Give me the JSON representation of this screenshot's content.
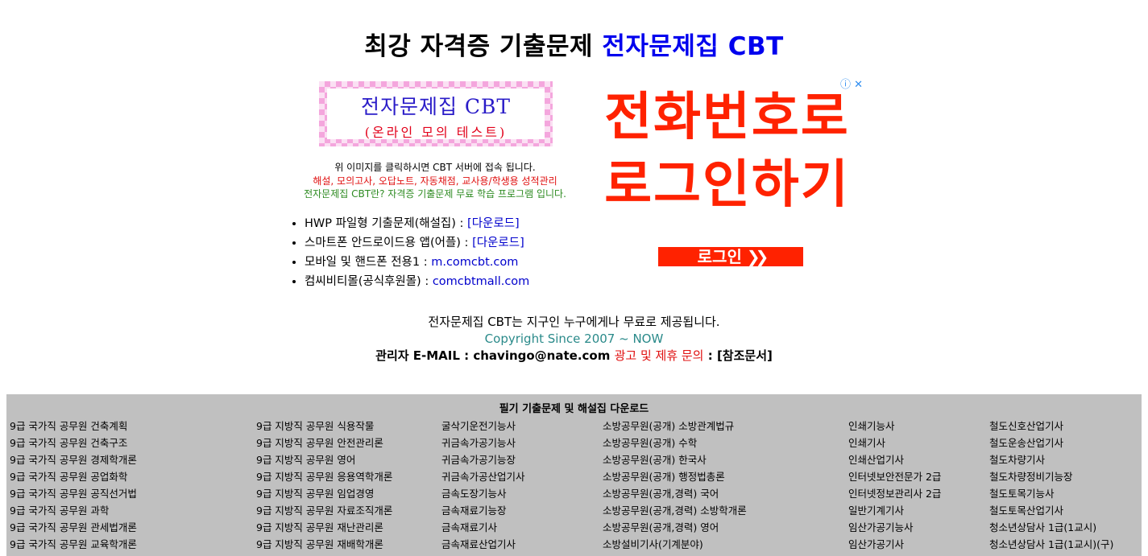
{
  "header": {
    "title_main": "최강 자격증 기출문제 ",
    "title_accent": "전자문제집 CBT"
  },
  "logo": {
    "line1": "전자문제집 CBT",
    "line2": "(온라인 모의 테스트)"
  },
  "info": {
    "line1": "위 이미지를 클릭하시면 CBT 서버에 접속 됩니다.",
    "line2": "해설, 모의고사, 오답노트, 자동채점, 교사용/학생용 성적관리",
    "line3": "전자문제집 CBT란? 자격증 기출문제 무료 학습 프로그램 입니다.",
    "colors": {
      "red": "#e01010",
      "green": "#2e8b22"
    }
  },
  "links": [
    {
      "label": "HWP 파일형 기출문제(해설집) : ",
      "link": "[다운로드]"
    },
    {
      "label": "스마트폰 안드로이드용 앱(어플) : ",
      "link": "[다운로드]"
    },
    {
      "label": "모바일 및 핸드폰 전용1 : ",
      "link": "m.comcbt.com"
    },
    {
      "label": "컴씨비티몰(공식후원몰) : ",
      "link": "comcbtmall.com"
    }
  ],
  "ad": {
    "headline1": "전화번호로",
    "headline2": "로그인하기",
    "button": "로그인",
    "adchoice": "ⓘ ✕",
    "color": "#ff2200"
  },
  "footer": {
    "line1": "전자문제집 CBT는 지구인 누구에게나 무료로 제공됩니다.",
    "copyright": "Copyright Since 2007 ~ NOW",
    "admin_label": "관리자 E-MAIL : chavingo@nate.com ",
    "ad_inquiry": "광고 및 제휴 문의",
    "sep": " : ",
    "ref": "[참조문서]"
  },
  "panel": {
    "title": "필기 기출문제 및 해설집 다운로드",
    "columns": [
      [
        "9급 국가직 공무원 건축계획",
        "9급 국가직 공무원 건축구조",
        "9급 국가직 공무원 경제학개론",
        "9급 국가직 공무원 공업화학",
        "9급 국가직 공무원 공직선거법",
        "9급 국가직 공무원 과학",
        "9급 국가직 공무원 관세법개론",
        "9급 국가직 공무원 교육학개론"
      ],
      [
        "9급 지방직 공무원 식용작물",
        "9급 지방직 공무원 안전관리론",
        "9급 지방직 공무원 영어",
        "9급 지방직 공무원 응용역학개론",
        "9급 지방직 공무원 임업경영",
        "9급 지방직 공무원 자료조직개론",
        "9급 지방직 공무원 재난관리론",
        "9급 지방직 공무원 재배학개론"
      ],
      [
        "굴삭기운전기능사",
        "귀금속가공기능사",
        "귀금속가공기능장",
        "귀금속가공산업기사",
        "금속도장기능사",
        "금속재료기능장",
        "금속재료기사",
        "금속재료산업기사"
      ],
      [
        "소방공무원(공개) 소방관계법규",
        "소방공무원(공개) 수학",
        "소방공무원(공개) 한국사",
        "소방공무원(공개) 행정법총론",
        "소방공무원(공개,경력) 국어",
        "소방공무원(공개,경력) 소방학개론",
        "소방공무원(공개,경력) 영어",
        "소방설비기사(기계분야)"
      ],
      [
        "인쇄기능사",
        "인쇄기사",
        "인쇄산업기사",
        "인터넷보안전문가 2급",
        "인터넷정보관리사 2급",
        "일반기계기사",
        "임산가공기능사",
        "임산가공기사"
      ],
      [
        "철도신호산업기사",
        "철도운송산업기사",
        "철도차량기사",
        "철도차량정비기능장",
        "철도토목기능사",
        "철도토목산업기사",
        "청소년상담사 1급(1교시)",
        "청소년상담사 1급(1교시)(구)"
      ]
    ]
  }
}
